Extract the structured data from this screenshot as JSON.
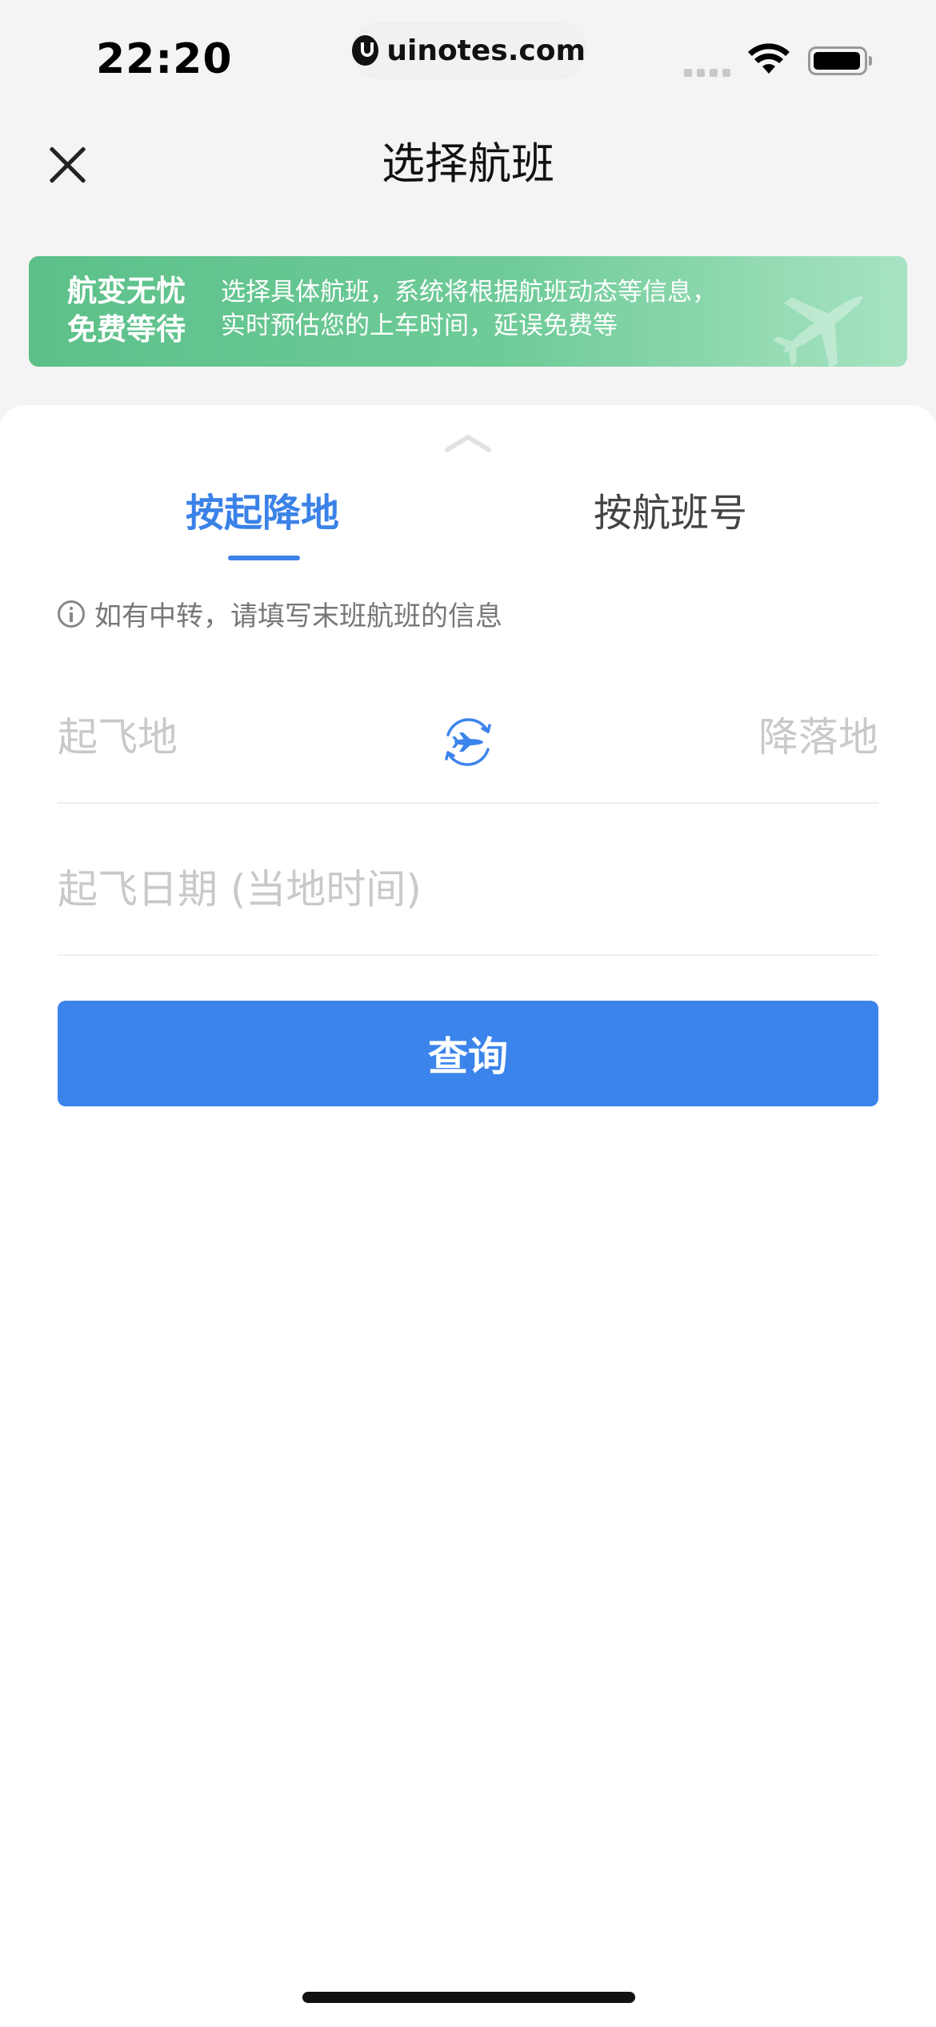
{
  "status_bar": {
    "time": "22:20",
    "url": "uinotes.com"
  },
  "nav": {
    "title": "选择航班"
  },
  "banner": {
    "title_line1": "航变无忧",
    "title_line2": "免费等待",
    "desc_line1": "选择具体航班，系统将根据航班动态等信息，",
    "desc_line2": "实时预估您的上车时间，延误免费等"
  },
  "tabs": [
    {
      "label": "按起降地",
      "active": true
    },
    {
      "label": "按航班号",
      "active": false
    }
  ],
  "tip": "如有中转，请填写末班航班的信息",
  "form": {
    "origin_placeholder": "起飞地",
    "destination_placeholder": "降落地",
    "date_placeholder": "起飞日期 (当地时间)"
  },
  "query_button": "查询",
  "colors": {
    "accent": "#3b84ec",
    "banner_green": "#5cc089",
    "placeholder": "#c9c9c9"
  }
}
